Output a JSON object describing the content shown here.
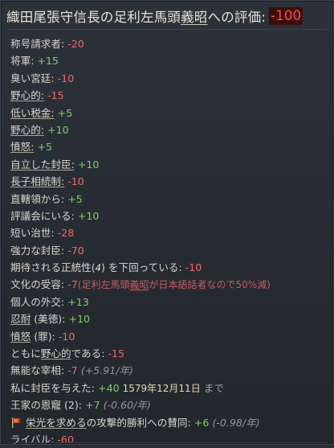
{
  "header": {
    "text_before": "織田尾張守信長の足利左馬頭",
    "text_underlined": "義昭",
    "text_after": "への評価:",
    "score": "-100"
  },
  "rows": [
    {
      "label": "称号請求者:",
      "value": "-20"
    },
    {
      "label": "将軍:",
      "value": "+15"
    },
    {
      "label": "臭い宮廷:",
      "value": "-10"
    },
    {
      "label": "野心的:",
      "value": "-15"
    },
    {
      "label": "低い税金:",
      "value": "+5"
    },
    {
      "label": "野心的:",
      "value": "+10"
    },
    {
      "label": "憤怒:",
      "value": "+5"
    },
    {
      "label": "自立した封臣:",
      "value": "+10"
    },
    {
      "label": "長子相続制:",
      "value": "-10"
    },
    {
      "label": "直轄領から:",
      "value": "+5"
    },
    {
      "label": "評議会にいる:",
      "value": "+10"
    },
    {
      "label": "短い治世:",
      "value": "-28"
    },
    {
      "label": "強力な封臣:",
      "value": "-70"
    },
    {
      "label_before": "期待される正統性(",
      "label_num": "4",
      "label_after": ") を下回っている:",
      "value": "-10"
    },
    {
      "label": "文化の受容:",
      "value": "-7",
      "note_before": "(足利左馬頭",
      "note_hl": "義昭",
      "note_after": "が日本語話者なので50%減)"
    },
    {
      "label": "個人の外交:",
      "value": "+13"
    },
    {
      "label_u": "忍耐",
      "label_rest": " (美徳):",
      "value": "+10"
    },
    {
      "label_u": "憤怒",
      "label_rest": " (罪):",
      "value": "-10"
    },
    {
      "label_before": "ともに",
      "label_u": "野心的",
      "label_after": "である:",
      "value": "-15"
    },
    {
      "label": "無能な宰相:",
      "value": "-7",
      "trend": "(+5.91/年)"
    },
    {
      "label": "私に封臣を与えた:",
      "value": "+40",
      "date": "1579年12月11日",
      "date_suffix": "まで"
    },
    {
      "label": "王家の恩寵 (2):",
      "value": "+7",
      "trend": "(-0.60/年)"
    },
    {
      "label_u": "栄光を求める",
      "label_rest": "の攻撃的勝利への賛同:",
      "value": "+6",
      "trend": "(-0.98/年)"
    },
    {
      "label": "ライバル:",
      "value": "-60"
    }
  ],
  "colors": {
    "negative": "#ee6a6a",
    "positive": "#7fcf6a",
    "score_bg": "#3b0d0d",
    "score_text": "#ff4b4b",
    "date": "#e6d7a8"
  },
  "icons": {
    "aggressive_victory": "banner-icon"
  }
}
